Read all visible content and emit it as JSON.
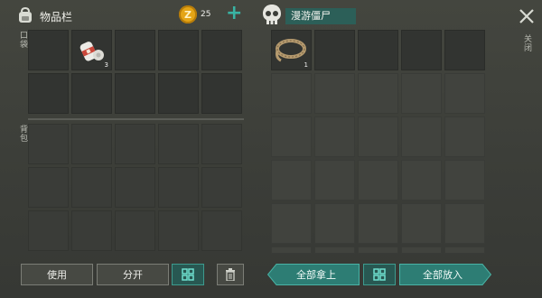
{
  "header": {
    "inventory_title": "物品栏",
    "coins": "25",
    "add_symbol": "+",
    "container_name": "漫游僵尸",
    "close_label": "关闭"
  },
  "left": {
    "pocket_label": "口袋",
    "backpack_label": "背包",
    "pocket_items": [
      {
        "slot": 1,
        "name": "bandage-icon",
        "count": "3"
      }
    ]
  },
  "right": {
    "items": [
      {
        "slot": 0,
        "name": "rope-icon",
        "count": "1"
      }
    ]
  },
  "buttons": {
    "use": "使用",
    "split": "分开",
    "take_all": "全部拿上",
    "put_all": "全部放入"
  },
  "colors": {
    "accent": "#2d7d74",
    "coin": "#e5a516"
  }
}
